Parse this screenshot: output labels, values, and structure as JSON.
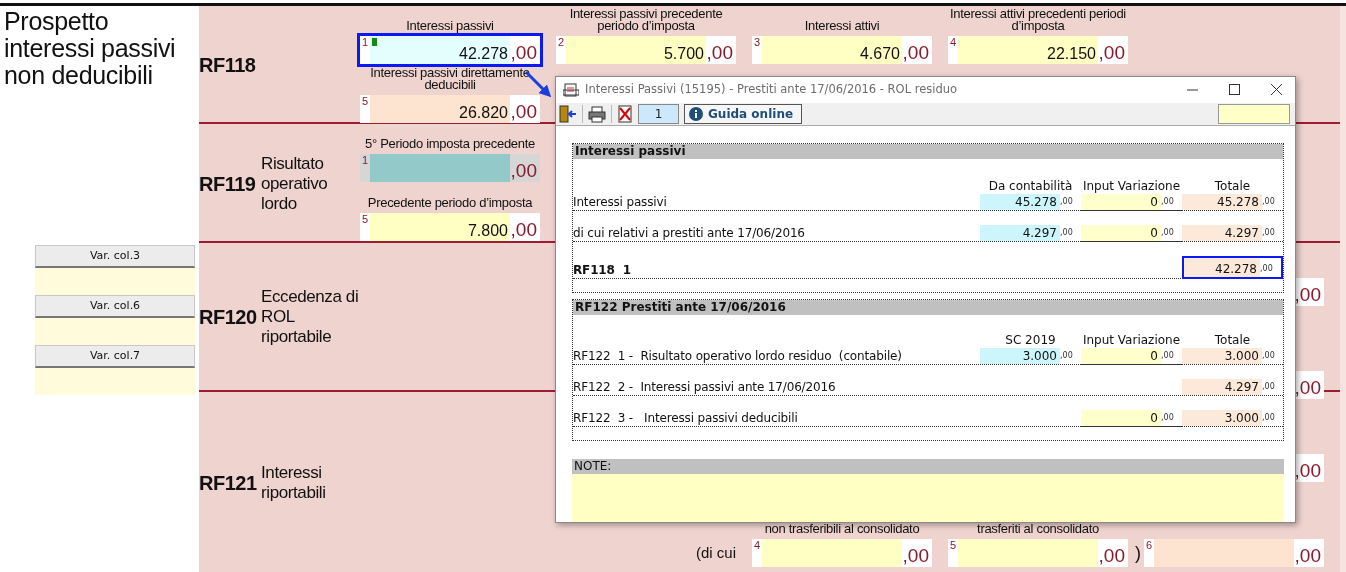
{
  "title": "Prospetto interessi passivi non deducibili",
  "side_buttons": [
    {
      "label": "Var. col.3"
    },
    {
      "label": "Var. col.6"
    },
    {
      "label": "Var. col.7"
    }
  ],
  "form_rows": [
    {
      "code": "RF118",
      "lines": [
        {
          "cells": [
            {
              "label": "Interessi passivi",
              "number": "1",
              "value": "42.278",
              "decimals": ",00",
              "kind": "imported",
              "highlighted": true,
              "marker": true
            },
            {
              "label": "Interessi passivi precedente periodo d’imposta",
              "number": "2",
              "value": "5.700",
              "decimals": ",00",
              "kind": "input",
              "highlighted": false,
              "marker": false
            },
            {
              "label": "Interessi attivi",
              "number": "3",
              "value": "4.670",
              "decimals": ",00",
              "kind": "input",
              "highlighted": false,
              "marker": false
            },
            {
              "label": "Interessi attivi precedenti periodi d’imposta",
              "number": "4",
              "value": "22.150",
              "decimals": ",00",
              "kind": "input",
              "highlighted": false,
              "marker": false
            },
            null
          ]
        },
        {
          "cells": [
            {
              "label": "Interessi passivi direttamente deducibili",
              "number": "5",
              "value": "26.820",
              "decimals": ",00",
              "kind": "calculated",
              "highlighted": false,
              "marker": false
            },
            null,
            null,
            null,
            null
          ]
        }
      ]
    },
    {
      "code": "RF119",
      "label": "Risultato operativo lordo",
      "lines": [
        {
          "cells": [
            {
              "label": "5° Periodo imposta precedente",
              "number": "1",
              "decimals": ",00",
              "kind": "locked",
              "highlighted": false,
              "marker": false
            },
            null,
            null,
            null,
            null
          ]
        },
        {
          "cells": [
            {
              "label": "Precedente periodo d’imposta",
              "number": "5",
              "value": "7.800",
              "decimals": ",00",
              "kind": "input",
              "highlighted": false,
              "marker": false
            },
            null,
            null,
            null,
            null
          ]
        }
      ]
    },
    {
      "code": "RF120",
      "label": "Eccedenza di ROL riportabile",
      "lines": [
        {
          "cells": [
            null,
            null,
            null,
            null,
            {
              "decimals": ",00",
              "highlighted": false,
              "marker": false
            }
          ]
        },
        {
          "cells": [
            null,
            null,
            null,
            null,
            {
              "decimals": ",00",
              "highlighted": false,
              "marker": false
            }
          ]
        }
      ]
    },
    {
      "code": "RF121",
      "label": "Interessi riportabili",
      "lines": [
        {
          "cells": [
            null,
            null,
            null,
            null,
            {
              "decimals": ",00",
              "highlighted": false,
              "marker": false
            }
          ]
        },
        {
          "cells": [
            null,
            {
              "kind": "text",
              "text": "(di cui"
            },
            {
              "label": "non trasferibili al consolidato",
              "number": "4",
              "decimals": ",00",
              "kind": "input",
              "highlighted": false,
              "marker": false
            },
            {
              "label": "trasferiti al consolidato",
              "number": "5",
              "decimals": ",00",
              "kind": "input",
              "highlighted": false,
              "marker": false,
              "after": ")"
            },
            {
              "number": "6",
              "decimals": ",00",
              "kind": "calculated",
              "highlighted": false,
              "marker": false
            }
          ]
        }
      ]
    }
  ],
  "dialog": {
    "title": "Interessi Passivi (15195) - Prestiti ante 17/06/2016 - ROL residuo",
    "toolbar": {
      "page": "1",
      "help_button": "Guida online"
    },
    "sections": [
      {
        "title": "Interessi passivi",
        "columns": [
          "Da contabilità",
          "Input Variazione",
          "Totale"
        ],
        "rows": [
          {
            "label": "Interessi passivi",
            "kind": "normal",
            "cells": [
              {
                "value": "45.278",
                "decimals": ",00",
                "kind": "imported",
                "highlighted": false
              },
              {
                "value": "0",
                "decimals": ",00",
                "kind": "input",
                "highlighted": false
              },
              {
                "value": "45.278",
                "decimals": ",00",
                "kind": "calculated",
                "highlighted": false
              }
            ]
          },
          {
            "label": "di cui relativi a prestiti ante 17/06/2016",
            "kind": "normal",
            "cells": [
              {
                "value": "4.297",
                "decimals": ",00",
                "kind": "imported",
                "highlighted": false
              },
              {
                "value": "0",
                "decimals": ",00",
                "kind": "input",
                "highlighted": false
              },
              {
                "value": "4.297",
                "decimals": ",00",
                "kind": "calculated",
                "highlighted": false
              }
            ]
          },
          {
            "label": "RF118  1",
            "kind": "total",
            "cells": [
              null,
              null,
              {
                "value": "42.278",
                "decimals": ",00",
                "kind": "calculated",
                "highlighted": true
              }
            ]
          }
        ]
      },
      {
        "title": "RF122 Prestiti ante 17/06/2016",
        "columns": [
          "SC 2019",
          "Input Variazione",
          "Totale"
        ],
        "rows": [
          {
            "label": "RF122  1 -  Risultato operativo lordo residuo  (contabile)",
            "kind": "normal",
            "cells": [
              {
                "value": "3.000",
                "decimals": ",00",
                "kind": "imported",
                "highlighted": false
              },
              {
                "value": "0",
                "decimals": ",00",
                "kind": "input",
                "highlighted": false
              },
              {
                "value": "3.000",
                "decimals": ",00",
                "kind": "calculated",
                "highlighted": false
              }
            ]
          },
          {
            "label": "RF122  2 -  Interessi passivi ante 17/06/2016",
            "kind": "normal",
            "cells": [
              null,
              null,
              {
                "value": "4.297",
                "decimals": ",00",
                "kind": "calculated",
                "highlighted": false
              }
            ]
          },
          {
            "label": "RF122  3 -   Interessi passivi deducibili",
            "kind": "normal",
            "cells": [
              null,
              {
                "value": "0",
                "decimals": ",00",
                "kind": "input",
                "highlighted": false
              },
              {
                "value": "3.000",
                "decimals": ",00",
                "kind": "calculated",
                "highlighted": false
              }
            ]
          }
        ]
      }
    ],
    "notes": {
      "label": "NOTE:"
    }
  }
}
